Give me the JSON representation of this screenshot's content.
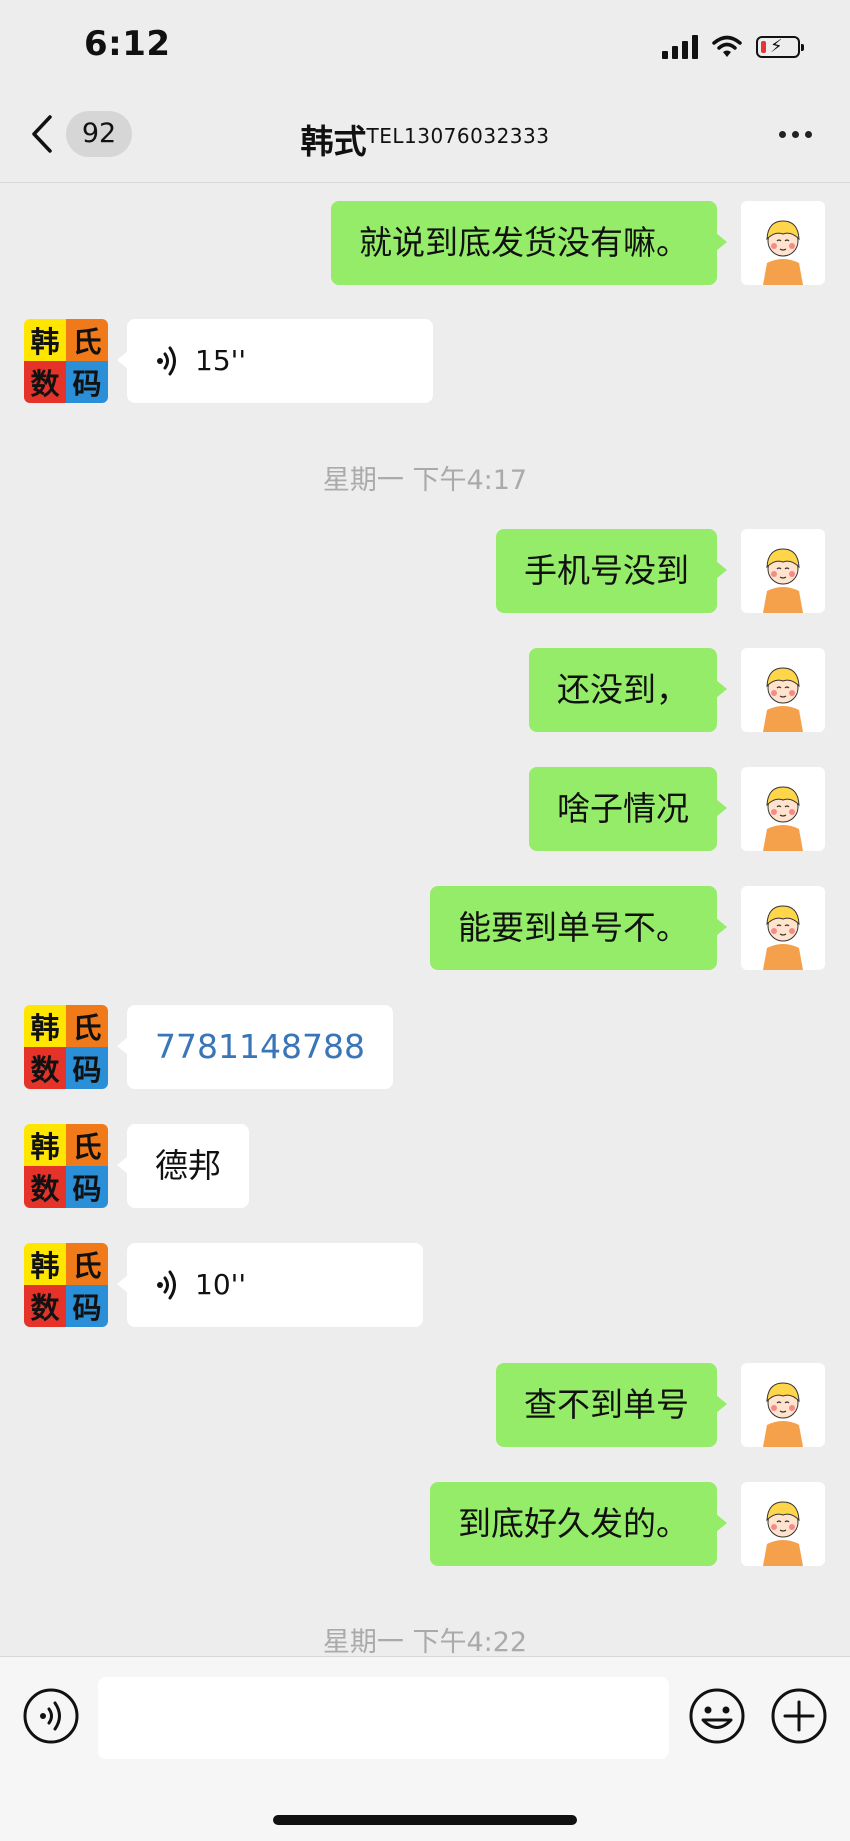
{
  "status_bar": {
    "time": "6:12"
  },
  "header": {
    "unread_count": "92",
    "title_name": "韩式",
    "title_apple": "",
    "title_tel": "TEL13076032333"
  },
  "messages": [
    {
      "side": "me",
      "type": "text",
      "text": "就说到底发货没有嘛。"
    },
    {
      "side": "them",
      "type": "voice",
      "text": "15''"
    },
    {
      "type": "time",
      "text": "星期一 下午4:17"
    },
    {
      "side": "me",
      "type": "text",
      "text": "手机号没到"
    },
    {
      "side": "me",
      "type": "text",
      "text": "还没到，"
    },
    {
      "side": "me",
      "type": "text",
      "text": "啥子情况"
    },
    {
      "side": "me",
      "type": "text",
      "text": "能要到单号不。"
    },
    {
      "side": "them",
      "type": "link",
      "text": "7781148788"
    },
    {
      "side": "them",
      "type": "text",
      "text": "德邦"
    },
    {
      "side": "them",
      "type": "voice",
      "text": "10''"
    },
    {
      "side": "me",
      "type": "text",
      "text": "查不到单号"
    },
    {
      "side": "me",
      "type": "text",
      "text": "到底好久发的。"
    },
    {
      "type": "time",
      "text": "星期一 下午4:22"
    }
  ],
  "contact_logo": [
    "韩",
    "氏",
    "数",
    "码"
  ],
  "colors": {
    "bubble_me": "#95ec69",
    "bubble_them": "#ffffff",
    "link": "#3a75b7",
    "logo_cells": [
      "#ffe600",
      "#f07a1a",
      "#e6332a",
      "#2a8fd6"
    ]
  },
  "input_bar": {
    "placeholder": ""
  },
  "icons": [
    "back-chevron-icon",
    "more-icon",
    "voice-wave-icon",
    "emoji-icon",
    "plus-icon"
  ]
}
